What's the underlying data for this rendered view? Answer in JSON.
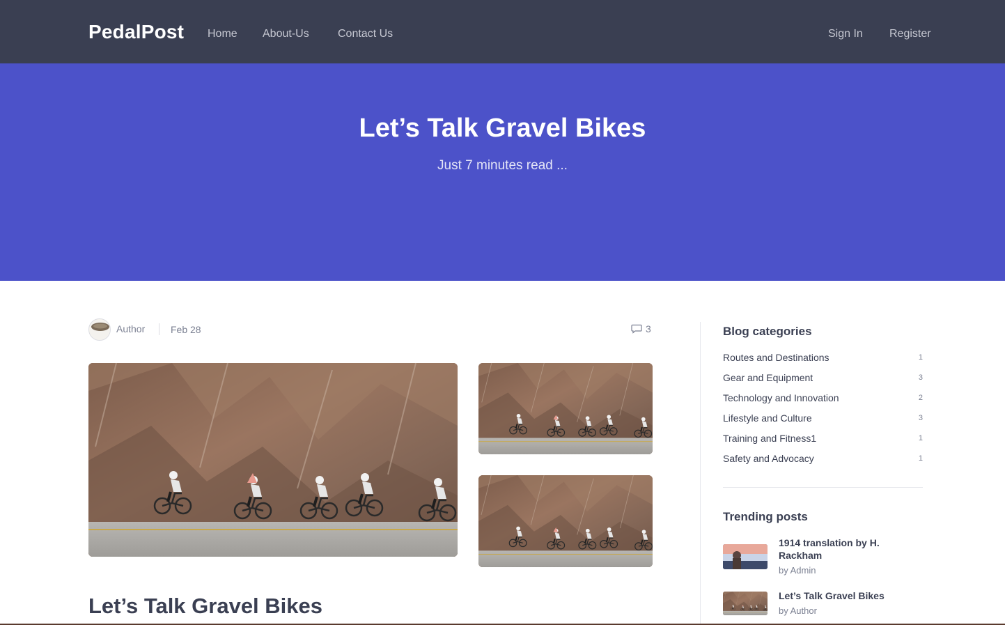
{
  "nav": {
    "brand": "PedalPost",
    "links": [
      "Home",
      "About-Us",
      "Contact Us"
    ],
    "sign_in": "Sign In",
    "register": "Register"
  },
  "hero": {
    "title": "Let’s Talk Gravel Bikes",
    "subtitle": "Just 7 minutes read ..."
  },
  "post": {
    "author": "Author",
    "date": "Feb 28",
    "comment_count": "3",
    "title": "Let’s Talk Gravel Bikes",
    "icons": {
      "comments": "comment-icon"
    }
  },
  "sidebar": {
    "categories_heading": "Blog categories",
    "categories": [
      {
        "name": "Routes and Destinations",
        "count": "1"
      },
      {
        "name": "Gear and Equipment",
        "count": "3"
      },
      {
        "name": "Technology and Innovation",
        "count": "2"
      },
      {
        "name": "Lifestyle and Culture",
        "count": "3"
      },
      {
        "name": "Training and Fitness1",
        "count": "1"
      },
      {
        "name": "Safety and Advocacy",
        "count": "1"
      }
    ],
    "trending_heading": "Trending posts",
    "trending": [
      {
        "title": "1914 translation by H. Rackham",
        "by": "by Admin"
      },
      {
        "title": "Let’s Talk Gravel Bikes",
        "by": "by Author"
      }
    ]
  },
  "colors": {
    "navbar": "#3a3f52",
    "hero": "#4c52c9",
    "text": "#3a3f52",
    "muted": "#7b8092"
  }
}
